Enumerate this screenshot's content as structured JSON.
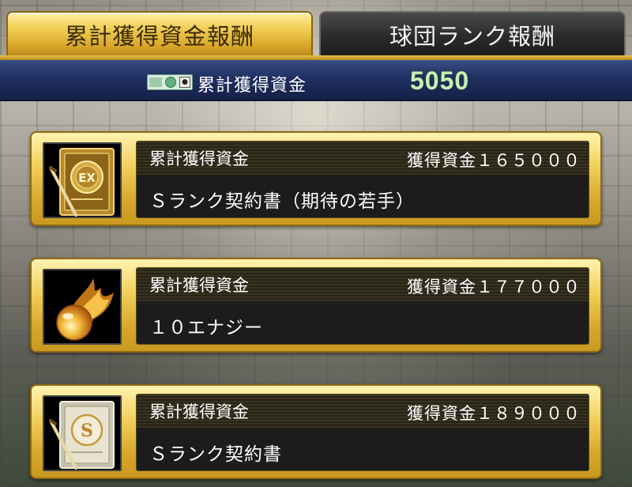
{
  "tabs": {
    "active_label": "累計獲得資金報酬",
    "inactive_label": "球団ランク報酬"
  },
  "total": {
    "label": "累計獲得資金",
    "value": "5050",
    "icon": "money-icon"
  },
  "rewards": [
    {
      "label": "累計獲得資金",
      "amount": "獲得資金１６５０００",
      "name": "Ｓランク契約書（期待の若手）",
      "icon": "contract-ex-icon"
    },
    {
      "label": "累計獲得資金",
      "amount": "獲得資金１７７０００",
      "name": "１０エナジー",
      "icon": "energy-fireball-icon"
    },
    {
      "label": "累計獲得資金",
      "amount": "獲得資金１８９０００",
      "name": "Ｓランク契約書",
      "icon": "contract-s-icon"
    }
  ],
  "colors": {
    "gold": "#d9a72a",
    "navy": "#1f2f60",
    "value_green": "#c7f0b2"
  }
}
